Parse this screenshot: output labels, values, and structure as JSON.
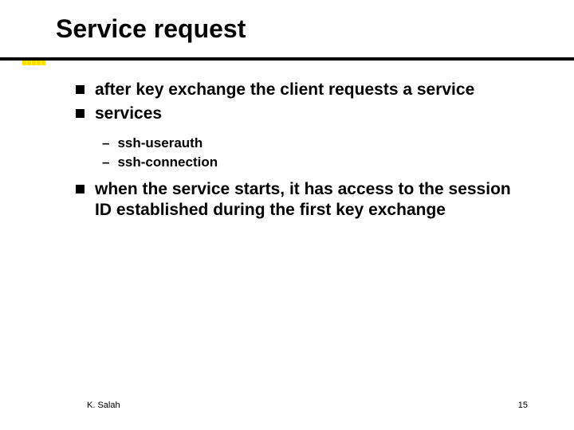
{
  "title": "Service request",
  "bullets": [
    {
      "text": "after key exchange the client requests a service"
    },
    {
      "text": "services"
    }
  ],
  "subbullets": [
    {
      "text": "ssh-userauth"
    },
    {
      "text": "ssh-connection"
    }
  ],
  "bullet3": "when the service starts, it has access to the session ID established during the first key exchange",
  "footer": {
    "author": "K. Salah",
    "page": "15"
  }
}
